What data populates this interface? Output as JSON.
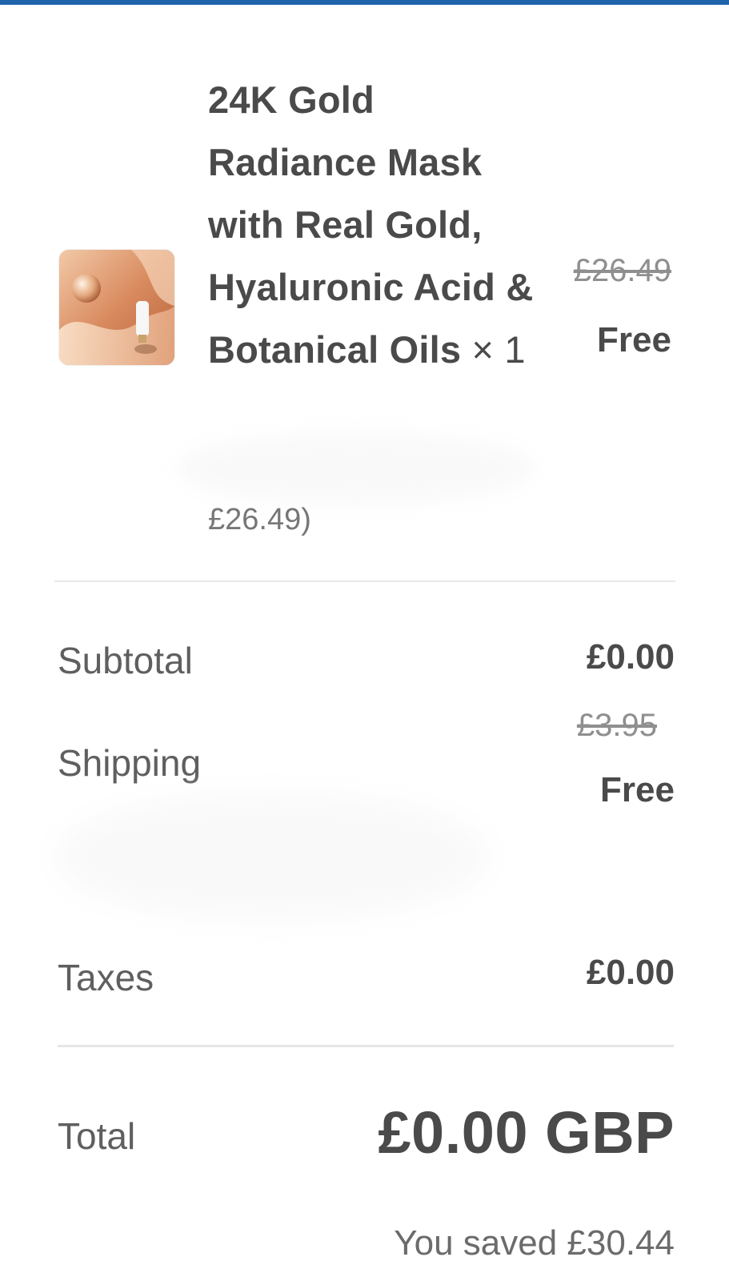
{
  "product": {
    "title": "24K Gold Radiance Mask with Real Gold, Hyaluronic Acid & Botanical Oils",
    "quantity_text": "× 1",
    "price_original": "£26.49",
    "price_now": "Free",
    "compare_text": "£26.49)",
    "thumbnail_icon": "product-thumbnail-image"
  },
  "summary": {
    "subtotal_label": "Subtotal",
    "subtotal_value": "£0.00",
    "shipping_label": "Shipping",
    "shipping_original": "£3.95",
    "shipping_value": "Free",
    "taxes_label": "Taxes",
    "taxes_value": "£0.00",
    "total_label": "Total",
    "total_value": "£0.00 GBP",
    "savings_text": "You saved £30.44"
  },
  "colors": {
    "accent_bar": "#1f63ad",
    "text_primary": "#4a4a4a",
    "text_muted": "#8f8f8f"
  }
}
